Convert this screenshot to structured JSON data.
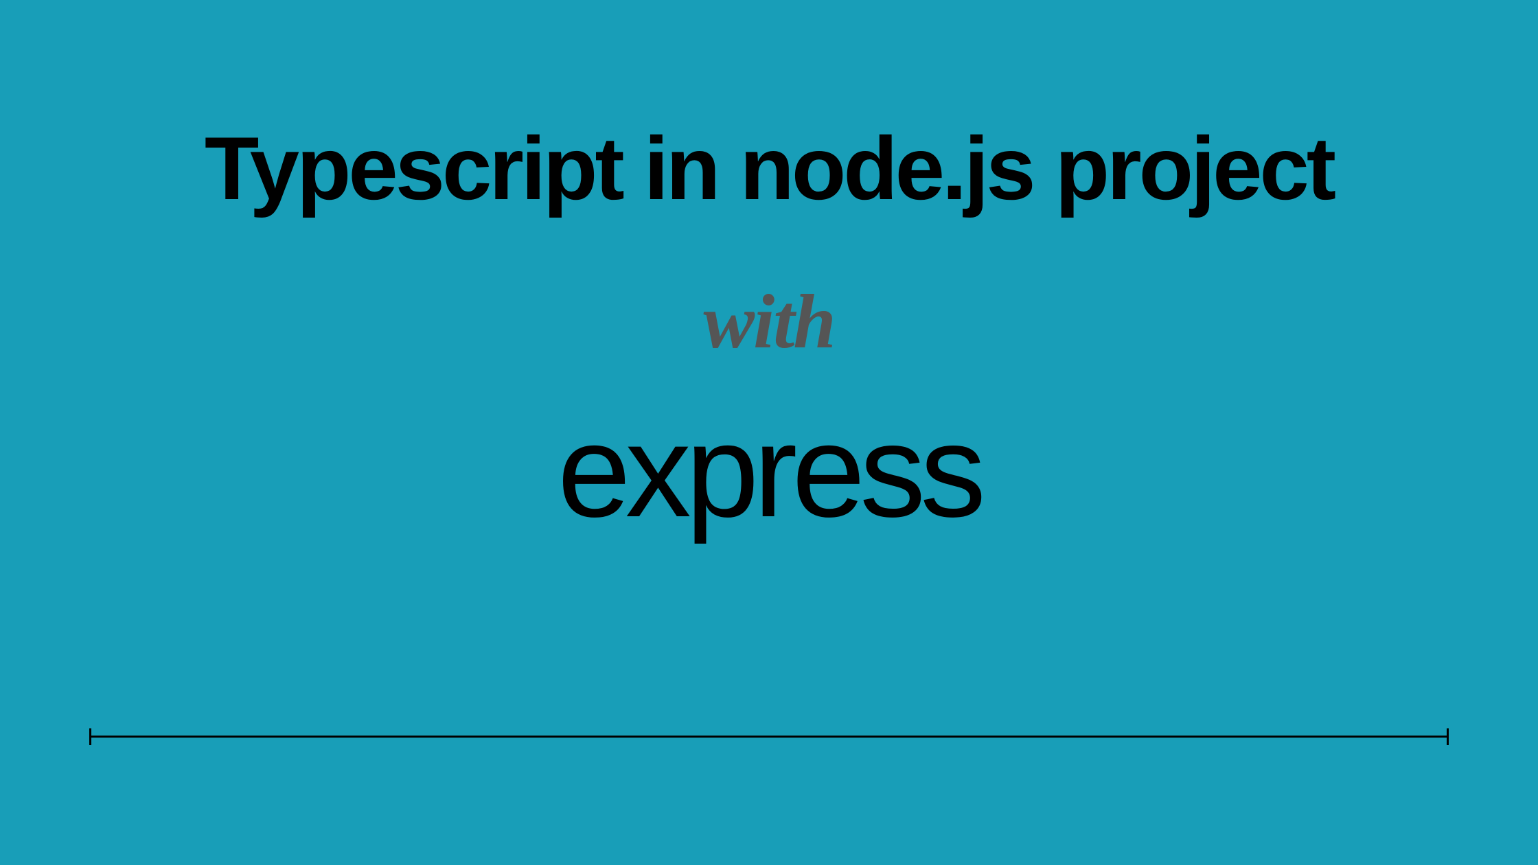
{
  "slide": {
    "title": "Typescript in node.js project",
    "with": "with",
    "framework": "express"
  }
}
